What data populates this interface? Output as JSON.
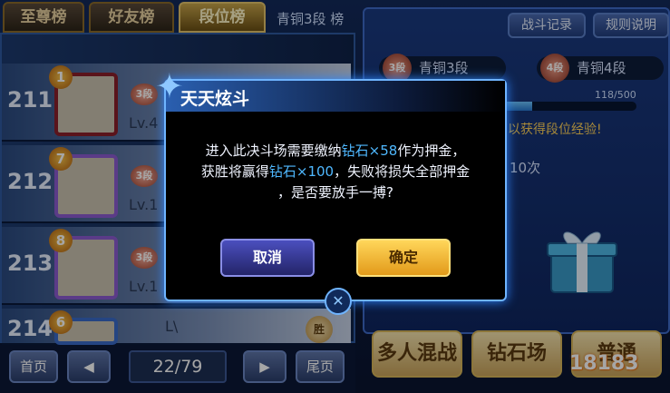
{
  "tabs": [
    {
      "label": "至尊榜",
      "active": false
    },
    {
      "label": "好友榜",
      "active": false
    },
    {
      "label": "段位榜",
      "active": true
    }
  ],
  "rank_label": "青铜3段 榜",
  "rows": [
    {
      "num": "211",
      "medal": "1",
      "badge": "3段",
      "level": "Lv.4"
    },
    {
      "num": "212",
      "medal": "7",
      "badge": "3段",
      "level": "Lv.1"
    },
    {
      "num": "213",
      "medal": "8",
      "badge": "3段",
      "level": "Lv.1"
    },
    {
      "num": "214",
      "medal": "6",
      "badge": "",
      "level": "L\\",
      "win": "胜"
    }
  ],
  "pager": {
    "first": "首页",
    "prev": "◀",
    "page": "22/79",
    "next": "▶",
    "last": "尾页"
  },
  "right_panel": {
    "battle_log": "战斗记录",
    "rules": "规则说明",
    "current_rank": {
      "icon": "3段",
      "name": "青铜3段"
    },
    "next_rank": {
      "icon": "4段",
      "name": "青铜4段"
    },
    "exp": "118/500",
    "exp_progress": 0.236,
    "hint": "以获得段位经验!",
    "count": "10次",
    "gift_icon": "gift-box-icon",
    "buttons": [
      "多人混战",
      "钻石场",
      "普通"
    ],
    "logo": "18183"
  },
  "dialog": {
    "title": "天天炫斗",
    "line1_a": "进入此决斗场需要缴纳",
    "line1_b": "钻石×58",
    "line1_c": "作为押金，",
    "line2_a": "获胜将赢得",
    "line2_b": "钻石×100",
    "line2_c": "，失败将损失全部押金",
    "line3": "，是否要放手一搏?",
    "cancel": "取消",
    "confirm": "确定"
  },
  "colors": {
    "accent": "#4fb8ff",
    "confirm": "#ffd65a",
    "cancel": "#4b4fbe",
    "gold": "#d8b65a"
  }
}
